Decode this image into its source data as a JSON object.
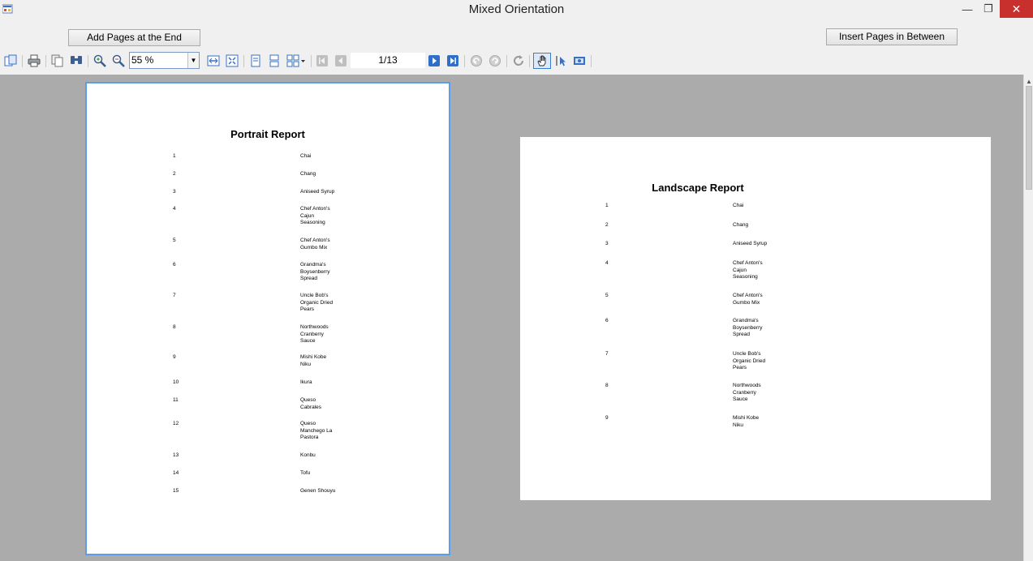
{
  "window": {
    "title": "Mixed Orientation",
    "close_glyph": "✕",
    "min_glyph": "—",
    "max_glyph": "❐"
  },
  "buttons": {
    "add_pages": "Add Pages at the End",
    "insert_pages": "Insert Pages in Between"
  },
  "toolbar": {
    "zoom_value": "55 %",
    "page_indicator": "1/13",
    "icons": [
      "open-icon",
      "print-icon",
      "copy-icon",
      "find-icon",
      "zoom-in-icon",
      "zoom-out-icon",
      "fit-width-icon",
      "fit-page-icon",
      "single-page-icon",
      "continuous-icon",
      "multipage-icon",
      "first-page-icon",
      "previous-page-icon",
      "next-page-icon",
      "last-page-icon",
      "back-icon",
      "forward-icon",
      "refresh-icon",
      "hand-tool-icon",
      "select-tool-icon",
      "snapshot-icon"
    ]
  },
  "portrait": {
    "title": "Portrait Report",
    "rows": [
      {
        "num": "1",
        "name": [
          "Chai"
        ]
      },
      {
        "num": "2",
        "name": [
          "Chang"
        ]
      },
      {
        "num": "3",
        "name": [
          "Aniseed Syrup"
        ]
      },
      {
        "num": "4",
        "name": [
          "Chef Anton's",
          "Cajun",
          "Seasoning"
        ]
      },
      {
        "num": "5",
        "name": [
          "Chef Anton's",
          "Gumbo Mix"
        ]
      },
      {
        "num": "6",
        "name": [
          "Grandma's",
          "Boysenberry",
          "Spread"
        ]
      },
      {
        "num": "7",
        "name": [
          "Uncle Bob's",
          "Organic Dried",
          "Pears"
        ]
      },
      {
        "num": "8",
        "name": [
          "Northwoods",
          "Cranberry",
          "Sauce"
        ]
      },
      {
        "num": "9",
        "name": [
          "Mishi Kobe",
          "Niku"
        ]
      },
      {
        "num": "10",
        "name": [
          "Ikura"
        ]
      },
      {
        "num": "11",
        "name": [
          "Queso",
          "Cabrales"
        ]
      },
      {
        "num": "12",
        "name": [
          "Queso",
          "Manchego La",
          "Pastora"
        ]
      },
      {
        "num": "13",
        "name": [
          "Konbu"
        ]
      },
      {
        "num": "14",
        "name": [
          "Tofu"
        ]
      },
      {
        "num": "15",
        "name": [
          "Genen Shouyu"
        ]
      }
    ]
  },
  "landscape": {
    "title": "Landscape Report",
    "rows": [
      {
        "num": "1",
        "name": [
          "Chai"
        ]
      },
      {
        "num": "2",
        "name": [
          "Chang"
        ]
      },
      {
        "num": "3",
        "name": [
          "Aniseed Syrup"
        ]
      },
      {
        "num": "4",
        "name": [
          "Chef Anton's",
          "Cajun",
          "Seasoning"
        ]
      },
      {
        "num": "5",
        "name": [
          "Chef Anton's",
          "Gumbo Mix"
        ]
      },
      {
        "num": "6",
        "name": [
          "Grandma's",
          "Boysenberry",
          "Spread"
        ]
      },
      {
        "num": "7",
        "name": [
          "Uncle Bob's",
          "Organic Dried",
          "Pears"
        ]
      },
      {
        "num": "8",
        "name": [
          "Northwoods",
          "Cranberry",
          "Sauce"
        ]
      },
      {
        "num": "9",
        "name": [
          "Mishi Kobe",
          "Niku"
        ]
      }
    ]
  }
}
